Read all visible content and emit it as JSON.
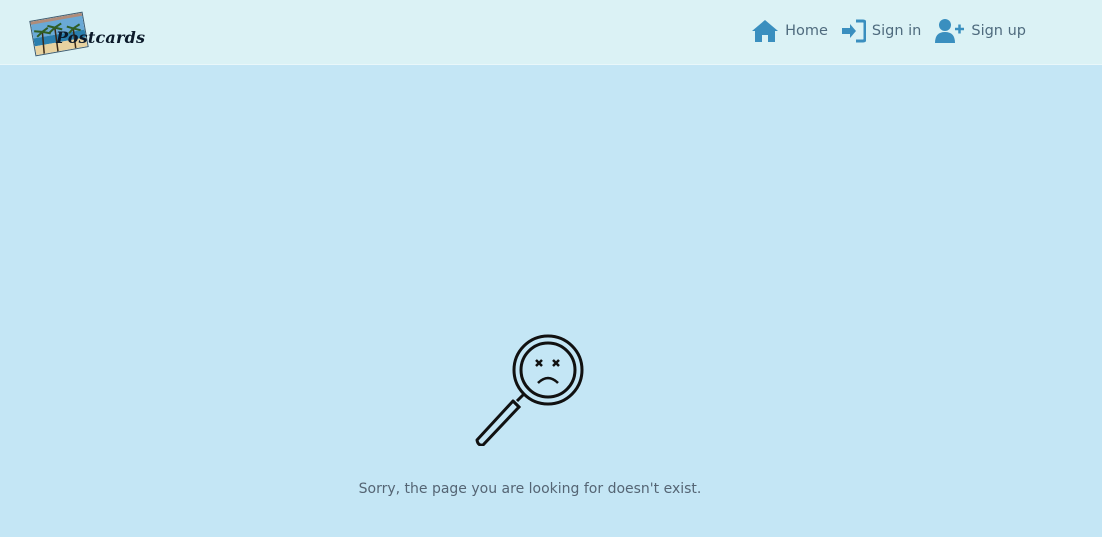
{
  "header": {
    "logo_text": "Postcards"
  },
  "nav": {
    "items": [
      {
        "label": "Home",
        "icon": "home-icon"
      },
      {
        "label": "Sign in",
        "icon": "sign-in-icon"
      },
      {
        "label": "Sign up",
        "icon": "user-plus-icon"
      }
    ]
  },
  "main": {
    "message": "Sorry, the page you are looking for doesn't exist.",
    "icon": "magnifier-sad-face-icon"
  },
  "colors": {
    "nav_background": "#dbf2f5",
    "page_background": "#c4e6f5",
    "icon_accent": "#3a8fbf",
    "text": "#4f6b7e"
  }
}
